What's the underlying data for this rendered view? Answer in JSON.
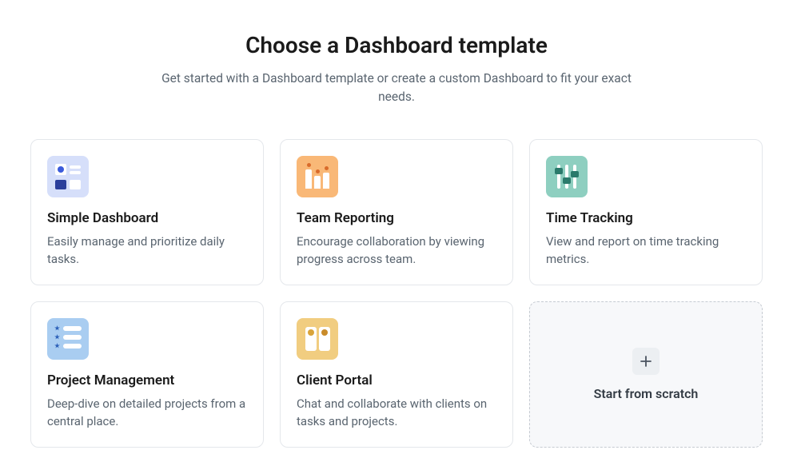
{
  "header": {
    "title": "Choose a Dashboard template",
    "subtitle": "Get started with a Dashboard template or create a custom Dashboard to fit your exact needs."
  },
  "templates": {
    "simple": {
      "title": "Simple Dashboard",
      "description": "Easily manage and prioritize daily tasks."
    },
    "team": {
      "title": "Team Reporting",
      "description": "Encourage collaboration by viewing progress across team."
    },
    "time": {
      "title": "Time Tracking",
      "description": "View and report on time tracking metrics."
    },
    "project": {
      "title": "Project Management",
      "description": "Deep-dive on detailed projects from a central place."
    },
    "client": {
      "title": "Client Portal",
      "description": "Chat and collaborate with clients on tasks and projects."
    }
  },
  "scratch": {
    "label": "Start from scratch"
  }
}
